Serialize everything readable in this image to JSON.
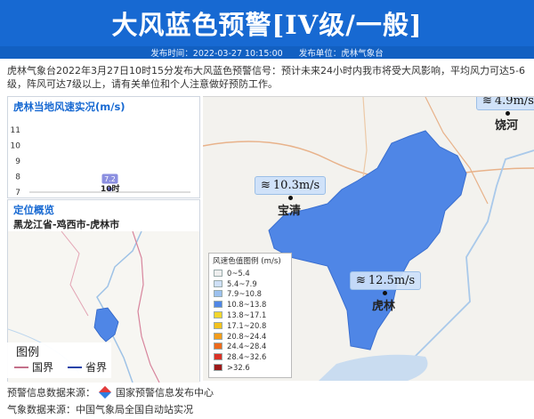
{
  "header": {
    "title": "大风蓝色预警[IV级/一般]",
    "publish_time": "发布时间：2022-03-27 10:15:00",
    "publisher": "发布单位：虎林气象台"
  },
  "description": "虎林气象台2022年3月27日10时15分发布大风蓝色预警信号：预计未来24小时内我市将受大风影响，平均风力可达5-6级，阵风可达7级以上，请有关单位和个人注意做好预防工作。",
  "wind_panel": {
    "title": "虎林当地风速实况(m/s)",
    "chart_data": {
      "type": "scatter",
      "title": "虎林当地风速实况(m/s)",
      "x": [
        "10时"
      ],
      "values": [
        7.2
      ],
      "yticks": [
        7,
        8,
        9,
        10,
        11
      ],
      "ylim": [
        7,
        11
      ]
    }
  },
  "location_panel": {
    "title": "定位概览",
    "path": "黑龙江省-鸡西市-虎林市",
    "legend_title": "图例",
    "legend_items": [
      "国界",
      "省界"
    ]
  },
  "map": {
    "legend_title": "风速色值图例 (m/s)",
    "legend": [
      {
        "label": "0~5.4",
        "color": "#eeeeee"
      },
      {
        "label": "5.4~7.9",
        "color": "#cfe0f7"
      },
      {
        "label": "7.9~10.8",
        "color": "#9cc1ef"
      },
      {
        "label": "10.8~13.8",
        "color": "#4f86e6"
      },
      {
        "label": "13.8~17.1",
        "color": "#f2d62e"
      },
      {
        "label": "17.1~20.8",
        "color": "#f3c21e"
      },
      {
        "label": "20.8~24.4",
        "color": "#f39c1c"
      },
      {
        "label": "24.4~28.4",
        "color": "#ec6a1c"
      },
      {
        "label": "28.4~32.6",
        "color": "#d93226"
      },
      {
        "label": ">32.6",
        "color": "#9c1a1a"
      }
    ],
    "stations": [
      {
        "wind": "10.3m/s",
        "name": "宝清"
      },
      {
        "wind": "12.5m/s",
        "name": "虎林"
      },
      {
        "wind": "4.9m/s",
        "name": "饶河"
      }
    ],
    "region_color": "#4f86e6"
  },
  "footer": {
    "source1_label": "预警信息数据来源：",
    "source1_value": "国家预警信息发布中心",
    "source2_label": "气象数据来源：",
    "source2_value": "中国气象局全国自动站实况"
  }
}
